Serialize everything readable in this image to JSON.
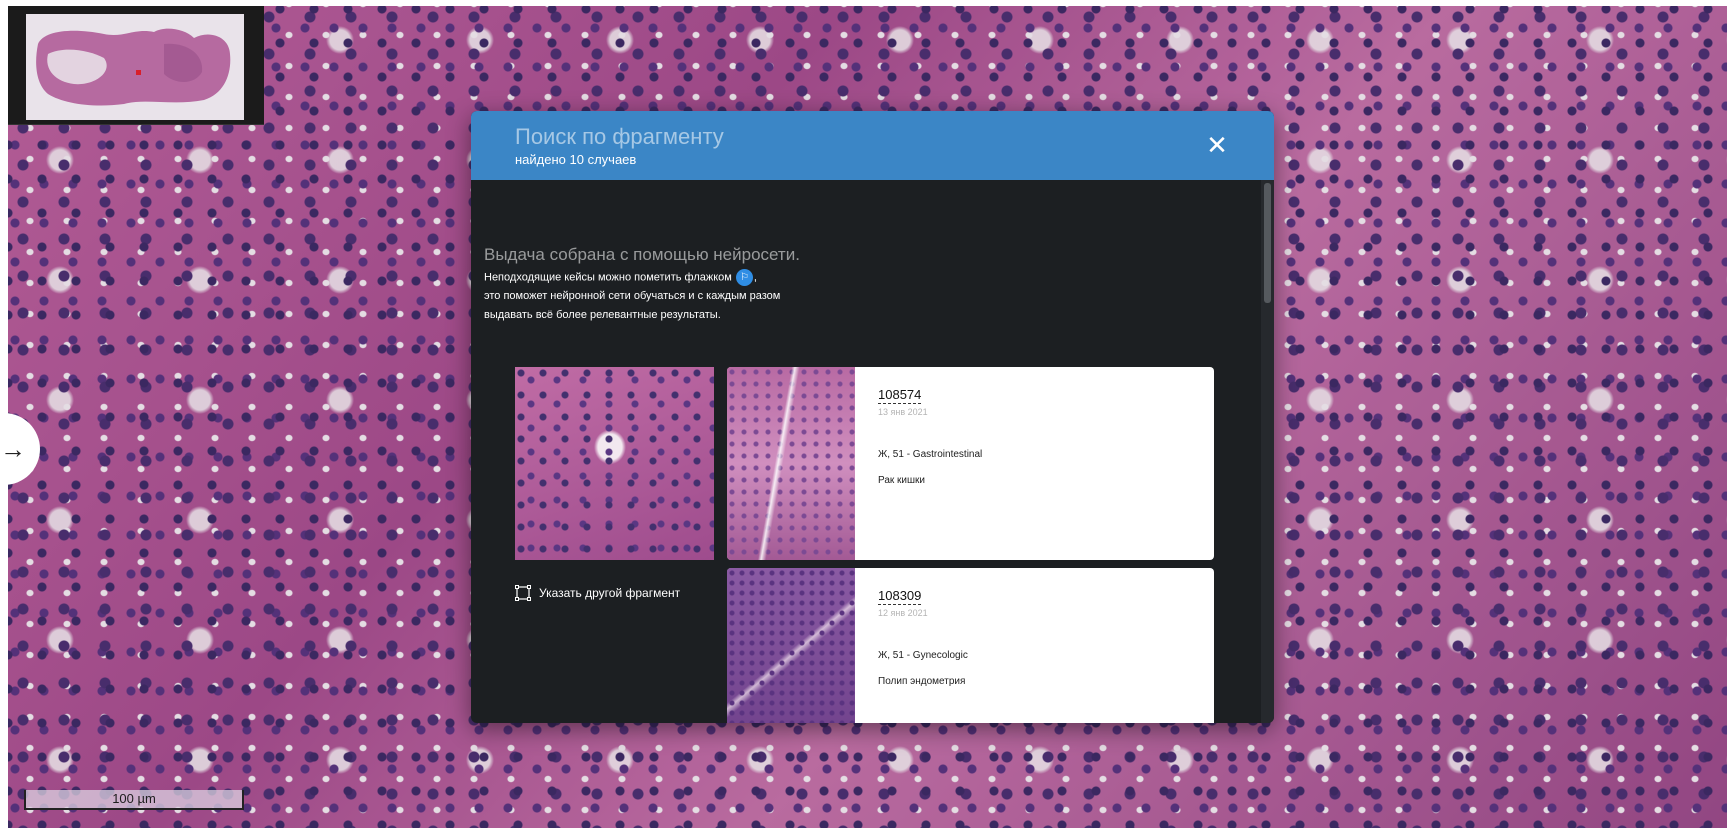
{
  "viewer": {
    "scale_label": "100 µm"
  },
  "modal": {
    "title": "Поиск по фрагменту",
    "subtitle": "найдено 10 случаев",
    "intro_heading": "Выдача собрана с помощью нейросети.",
    "intro_line1_before": "Неподходящие кейсы можно пометить флажком",
    "intro_line1_after": ",",
    "intro_line2": "это поможет нейронной сети обучаться и с каждым разом",
    "intro_line3": "выдавать всё более релевантные результаты.",
    "other_fragment_label": "Указать другой фрагмент"
  },
  "results": [
    {
      "id": "108574",
      "date": "13 янв 2021",
      "patient": "Ж, 51 - Gastrointestinal",
      "diagnosis": "Рак кишки"
    },
    {
      "id": "108309",
      "date": "12 янв 2021",
      "patient": "Ж, 51 - Gynecologic",
      "diagnosis": "Полип эндометрия"
    }
  ],
  "colors": {
    "header": "#3b86c6",
    "modal_bg": "#1c1f22",
    "flag_badge": "#2f8de4"
  },
  "icons": {
    "close": "close-icon",
    "side_arrow": "arrow-right-icon",
    "flag": "flag-icon",
    "fragment": "selection-frame-icon"
  }
}
